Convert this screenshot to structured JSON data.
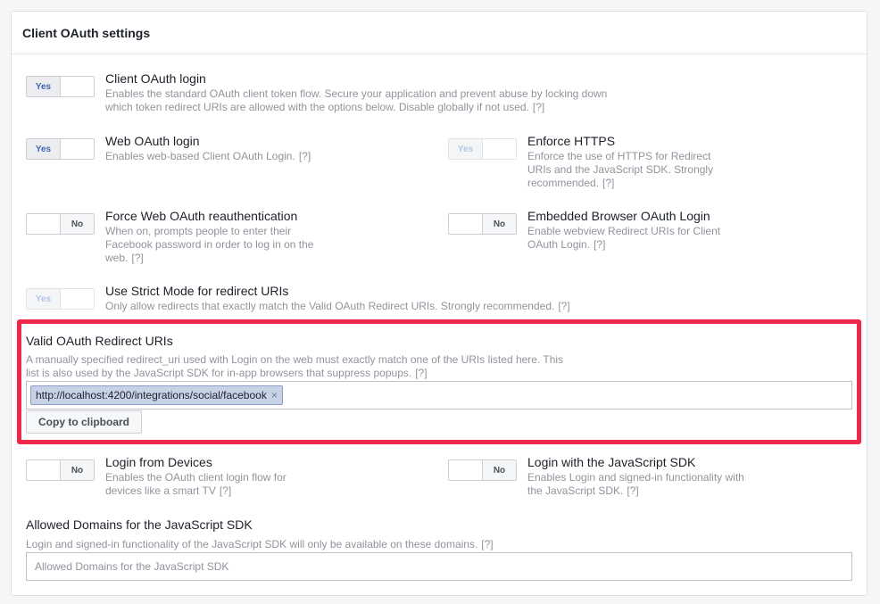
{
  "panel": {
    "title": "Client OAuth settings"
  },
  "help": "[?]",
  "toggles": {
    "yes": "Yes",
    "no": "No"
  },
  "settings": {
    "client_oauth": {
      "title": "Client OAuth login",
      "desc": "Enables the standard OAuth client token flow. Secure your application and prevent abuse by locking down which token redirect URIs are allowed with the options below. Disable globally if not used.",
      "state": "Yes"
    },
    "web_oauth": {
      "title": "Web OAuth login",
      "desc": "Enables web-based Client OAuth Login.",
      "state": "Yes"
    },
    "enforce_https": {
      "title": "Enforce HTTPS",
      "desc": "Enforce the use of HTTPS for Redirect URIs and the JavaScript SDK. Strongly recommended.",
      "state": "Yes",
      "disabled": true
    },
    "force_reauth": {
      "title": "Force Web OAuth reauthentication",
      "desc": "When on, prompts people to enter their Facebook password in order to log in on the web.",
      "state": "No"
    },
    "embedded_browser": {
      "title": "Embedded Browser OAuth Login",
      "desc": "Enable webview Redirect URIs for Client OAuth Login.",
      "state": "No"
    },
    "strict_mode": {
      "title": "Use Strict Mode for redirect URIs",
      "desc": "Only allow redirects that exactly match the Valid OAuth Redirect URIs. Strongly recommended.",
      "state": "Yes",
      "disabled": true
    },
    "login_devices": {
      "title": "Login from Devices",
      "desc": "Enables the OAuth client login flow for devices like a smart TV",
      "state": "No"
    },
    "login_js_sdk": {
      "title": "Login with the JavaScript SDK",
      "desc": "Enables Login and signed-in functionality with the JavaScript SDK.",
      "state": "No"
    }
  },
  "redirect_uris": {
    "title": "Valid OAuth Redirect URIs",
    "desc": "A manually specified redirect_uri used with Login on the web must exactly match one of the URIs listed here. This list is also used by the JavaScript SDK for in-app browsers that suppress popups.",
    "uris": [
      "http://localhost:4200/integrations/social/facebook"
    ],
    "remove_glyph": "×",
    "copy_label": "Copy to clipboard"
  },
  "allowed_domains": {
    "title": "Allowed Domains for the JavaScript SDK",
    "desc": "Login and signed-in functionality of the JavaScript SDK will only be available on these domains.",
    "placeholder": "Allowed Domains for the JavaScript SDK",
    "value": ""
  },
  "colors": {
    "highlight": "#f02849",
    "accent": "#4267b2",
    "token_bg": "#c8d2e6"
  }
}
